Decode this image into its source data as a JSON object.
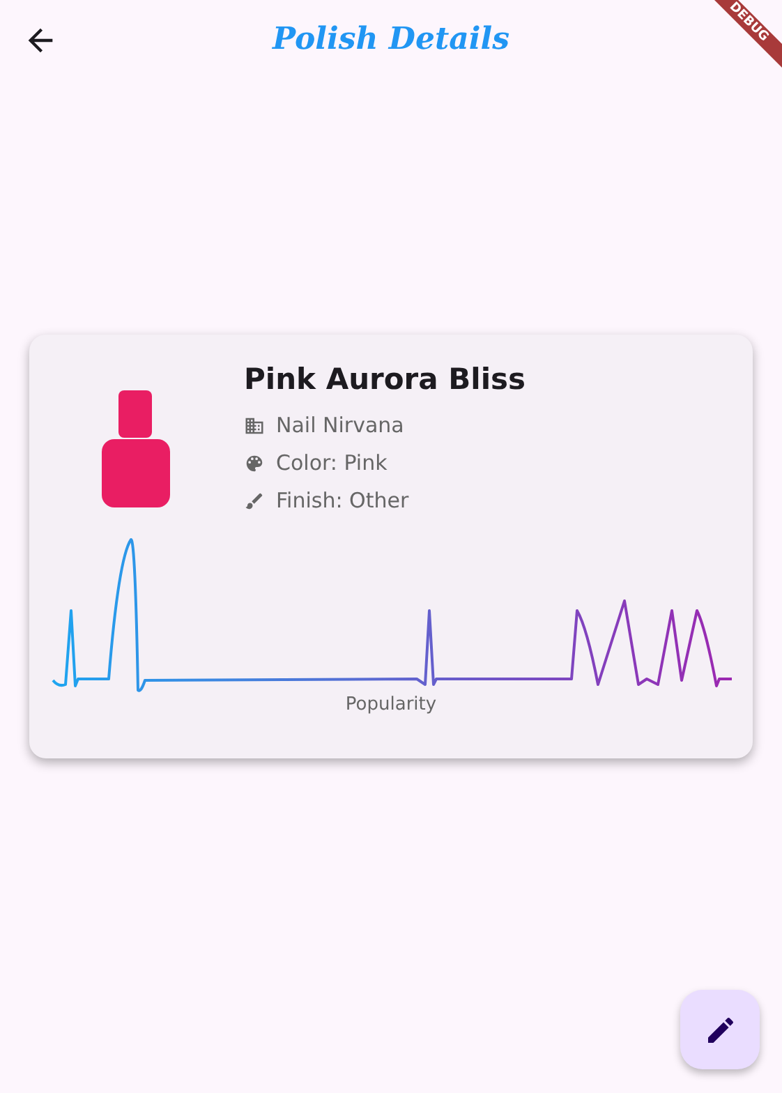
{
  "app_bar": {
    "title": "Polish Details"
  },
  "debug_banner": {
    "text": "DEBUG"
  },
  "card": {
    "name": "Pink Aurora Bliss",
    "details": [
      {
        "kind": "brand",
        "text": "Nail Nirvana"
      },
      {
        "kind": "color",
        "text": "Color: Pink"
      },
      {
        "kind": "finish",
        "text": "Finish: Other"
      }
    ],
    "chart_label": "Popularity"
  }
}
